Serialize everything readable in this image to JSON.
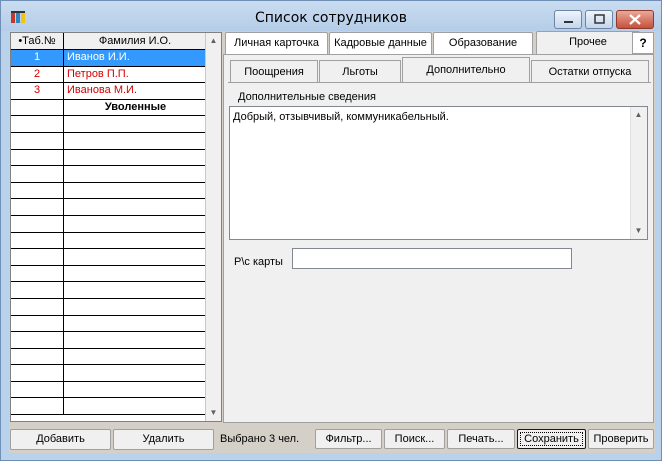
{
  "window": {
    "title": "Список сотрудников",
    "buttons": {
      "minimize": "minimize-icon",
      "maximize": "maximize-icon",
      "close": "close-icon"
    }
  },
  "grid": {
    "columns": [
      "•Таб.№",
      "Фамилия И.О."
    ],
    "rows": [
      {
        "num": "1",
        "name": "Иванов И.И.",
        "selected": true
      },
      {
        "num": "2",
        "name": "Петров П.П.",
        "selected": false
      },
      {
        "num": "3",
        "name": "Иванова М.И.",
        "selected": false
      },
      {
        "num": "",
        "name": "Уволенные",
        "group": true
      }
    ]
  },
  "tabs": [
    "Личная карточка",
    "Кадровые данные",
    "Образование",
    "Прочее"
  ],
  "active_tab": "Прочее",
  "help": "?",
  "subtabs": [
    "Поощрения",
    "Льготы",
    "Дополнительно",
    "Остатки отпуска"
  ],
  "active_subtab": "Дополнительно",
  "details": {
    "label": "Дополнительные сведения",
    "text": "Добрый, отзывчивый, коммуникабельный.",
    "card_label": "Р\\с карты",
    "card_value": ""
  },
  "footer": {
    "add": "Добавить",
    "delete": "Удалить",
    "status": "Выбрано 3 чел.",
    "filter": "Фильтр...",
    "search": "Поиск...",
    "print": "Печать...",
    "save": "Сохранить",
    "check": "Проверить"
  },
  "colors": {
    "selection": "#3399ff",
    "employee_text": "#d40000",
    "titlebar": "#b9d1ea",
    "panel": "#f0f0f0"
  }
}
